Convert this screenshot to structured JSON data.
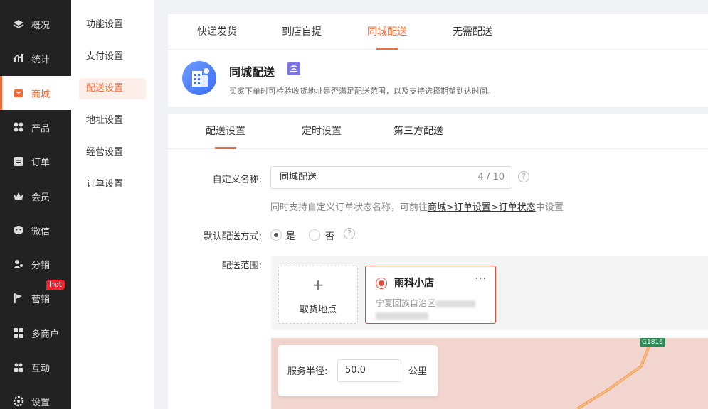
{
  "nav": {
    "items": [
      {
        "label": "概况",
        "icon": "layers-icon"
      },
      {
        "label": "统计",
        "icon": "chart-icon"
      },
      {
        "label": "商城",
        "icon": "shop-icon"
      },
      {
        "label": "产品",
        "icon": "grid-icon"
      },
      {
        "label": "订单",
        "icon": "clipboard-icon"
      },
      {
        "label": "会员",
        "icon": "crown-icon"
      },
      {
        "label": "微信",
        "icon": "wechat-icon"
      },
      {
        "label": "分销",
        "icon": "users-icon"
      },
      {
        "label": "营销",
        "icon": "flag-icon"
      },
      {
        "label": "多商户",
        "icon": "store-icon"
      },
      {
        "label": "互动",
        "icon": "people-icon"
      },
      {
        "label": "设置",
        "icon": "gear-icon"
      }
    ],
    "active_index": 2,
    "hot_badge": "hot"
  },
  "submenu": {
    "items": [
      "功能设置",
      "支付设置",
      "配送设置",
      "地址设置",
      "经营设置",
      "订单设置"
    ],
    "active_index": 2
  },
  "top_tabs": [
    "快递发货",
    "到店自提",
    "同城配送",
    "无需配送"
  ],
  "top_active": 2,
  "intro": {
    "title": "同城配送",
    "description": "买家下单时可检验收货地址是否满足配送范围，以及支持选择期望到达时间。"
  },
  "panel_tabs": [
    "配送设置",
    "定时设置",
    "第三方配送"
  ],
  "panel_active": 0,
  "form": {
    "name_label": "自定义名称:",
    "name_value": "同城配送",
    "name_counter": "4 / 10",
    "help": "?",
    "hint_prefix": "同时支持自定义订单状态名称，可前往",
    "hint_link": "商城>订单设置>订单状态",
    "hint_suffix": "中设置",
    "default_label": "默认配送方式:",
    "yes": "是",
    "no": "否",
    "range_label": "配送范围:"
  },
  "pickup": {
    "plus": "+",
    "label": "取货地点"
  },
  "store": {
    "name": "雨科小店",
    "more": "···",
    "addr_prefix": "宁夏回族自治区"
  },
  "radius": {
    "label": "服务半径:",
    "value": "50.0",
    "unit": "公里"
  },
  "map": {
    "road_label": "G1816"
  },
  "colors": {
    "accent": "#ef6b3a",
    "nav_bg": "#222222",
    "store_border": "#e84a3a"
  }
}
